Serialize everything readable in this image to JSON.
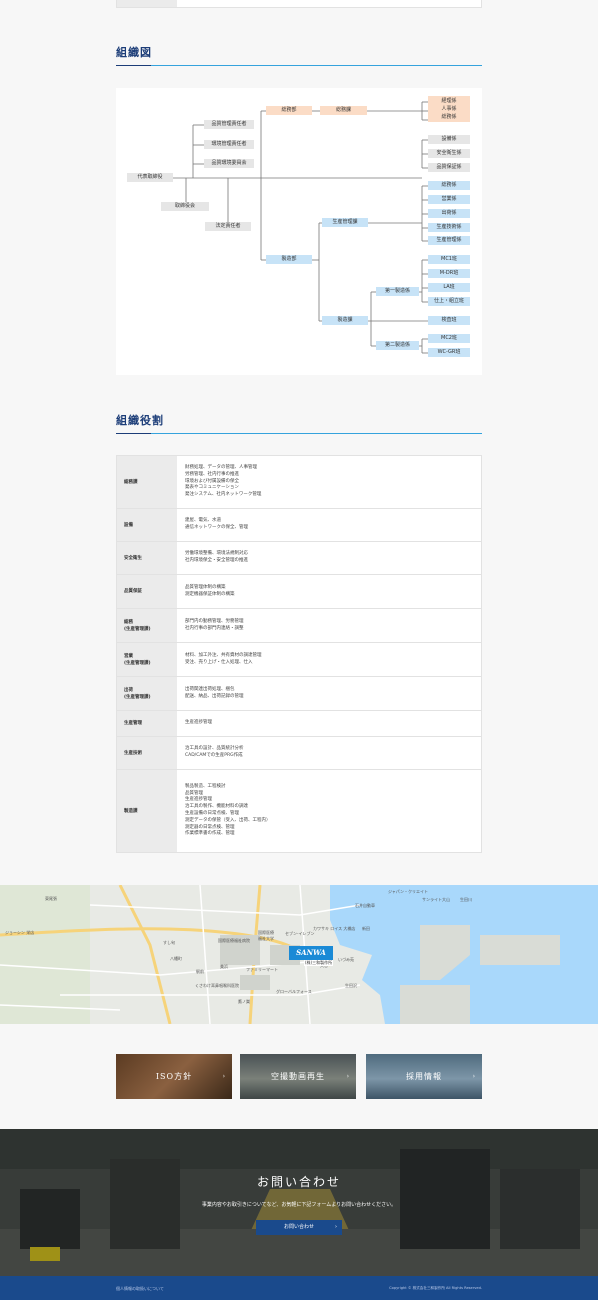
{
  "sections": {
    "org_chart_title": "組織図",
    "roles_title": "組織役割"
  },
  "org": {
    "president": "代表取締役",
    "board": "取締役会",
    "statutory": "法定責任者",
    "quality_mgr": "品質管理責任者",
    "env_mgr": "環境管理責任者",
    "quality_committee": "品質環境委員会",
    "general_dept": "総務部",
    "general_sec": "総務課",
    "general_units": [
      "経理係",
      "人事係",
      "総務係"
    ],
    "mid_units": [
      "設備係",
      "安全衛生係",
      "品質保証係"
    ],
    "mfg_dept": "製造部",
    "prod_mgmt_sec": "生産管理課",
    "prod_units": [
      "総務係",
      "営業係",
      "出荷係",
      "生産技術係",
      "生産管理係"
    ],
    "mfg_sec": "製造課",
    "mfg1": "第一製造係",
    "mfg1_units": [
      "MC1班",
      "M-DR班",
      "LA班",
      "仕上・組立班"
    ],
    "inspection": "検査班",
    "mfg2": "第二製造係",
    "mfg2_units": [
      "MC2班",
      "WC-GR班"
    ]
  },
  "roles": [
    {
      "head": [
        "総務課"
      ],
      "body": [
        "財務処理、データの管理、人事管理",
        "労務管理、社内行事の推進",
        "環境および付属設備の保全",
        "発表やコミュニケーション",
        "発注システム、社内ネットワーク管理"
      ]
    },
    {
      "head": [
        "設備"
      ],
      "body": [
        "建屋、電気、水道",
        "通信ネットワークの保全、管理"
      ]
    },
    {
      "head": [
        "安全衛生"
      ],
      "body": [
        "労働環境整備、環境法規制対応",
        "社内環境保全・安全管理の推進"
      ]
    },
    {
      "head": [
        "品質保証"
      ],
      "body": [
        "品質管理体制の構築",
        "測定機器保証体制の構築"
      ]
    },
    {
      "head": [
        "総務",
        "(生産管理課)"
      ],
      "body": [
        "部門内の勤務管理、労務管理",
        "社内行事の部門内連絡・調整"
      ]
    },
    {
      "head": [
        "営業",
        "(生産管理課)"
      ],
      "body": [
        "材料、加工外注、共有資材の調達管理",
        "受注、売り上げ・仕入処理、仕入"
      ]
    },
    {
      "head": [
        "出荷",
        "(生産管理課)"
      ],
      "body": [
        "出荷関連出荷処理、梱包",
        "配送、納品、出荷記録の管理"
      ]
    },
    {
      "head": [
        "生産管理"
      ],
      "body": [
        "生産進捗管理"
      ]
    },
    {
      "head": [
        "生産技術"
      ],
      "body": [
        "治工具の設計、品質統計分析",
        "CAD/CAMでの生産PRG作成"
      ]
    },
    {
      "head": [
        "製造課"
      ],
      "body": [
        "製品製造、工程検討",
        "品質管理",
        "生産進捗管理",
        "治工具の製作、機能材料の調達",
        "生産設備の日常点検、管理",
        "測定データの保管（受入、出荷、工程内）",
        "測定器の日常点検、管理",
        "作業標準書の作成、管理"
      ]
    }
  ],
  "map": {
    "marker_name": "SANWA",
    "marker_sub": "(株)三和製作所",
    "labels": [
      "ジャパン・クリエイト",
      "東尾張",
      "石井自動車",
      "サンライト大山",
      "生田川",
      "カワサキ ロイス 大橋店",
      "新田",
      "国際医療",
      "福祉大学",
      "セブン-イレブン",
      "国際医療福祉病院",
      "八幡町",
      "すし旬",
      "大谷",
      "いづみ苑",
      "グローバルフォース",
      "くさわけ耳鼻咽喉科医院",
      "鷹ノ巣",
      "ファミリーマート",
      "美浜",
      "生田沢",
      "駅前",
      "ジョーシン 栄店"
    ]
  },
  "banners": [
    {
      "label": "ISO方針"
    },
    {
      "label": "空撮動画再生"
    },
    {
      "label": "採用情報"
    }
  ],
  "contact": {
    "title": "お問い合わせ",
    "subtitle": "事業内容やお取引きについてなど、お気軽に下記フォームよりお問い合わせください。",
    "button": "お問い合わせ"
  },
  "footer": {
    "link": "個人情報の取扱いについて",
    "copyright": "Copyright © 株式会社三和製作所 All Rights Reserved."
  },
  "colors": {
    "accent_navy": "#1c3d78",
    "accent_blue": "#35a3dd",
    "node_peach": "#fbdcc6",
    "node_blue": "#c7e3f7",
    "footer": "#1a4a8c"
  }
}
